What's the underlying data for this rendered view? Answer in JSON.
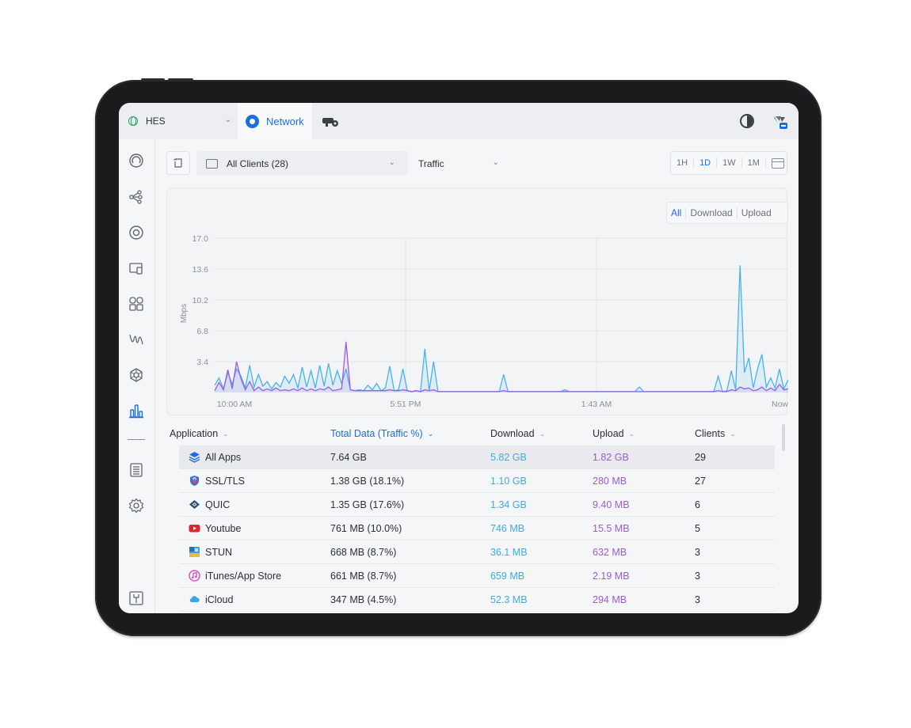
{
  "topbar": {
    "site_name": "HES",
    "network_tab_label": "Network",
    "site_chevron": "⌄"
  },
  "toolbar": {
    "clients_select": "All Clients (28)",
    "metric_select": "Traffic",
    "ranges": [
      "1H",
      "1D",
      "1W",
      "1M"
    ],
    "active_range": "1D",
    "chevron": "⌄"
  },
  "chart": {
    "direction_tabs": [
      "All",
      "Download",
      "Upload"
    ],
    "active_direction": "All",
    "y_ticks": [
      "17.0",
      "13.6",
      "10.2",
      "6.8",
      "3.4"
    ],
    "ylabel": "Mbps",
    "x_ticks": [
      "10:00 AM",
      "5:51 PM",
      "1:43 AM",
      "Now"
    ],
    "download_color": "#4ab3e8",
    "upload_color": "#9b5de5"
  },
  "chart_data": {
    "type": "area",
    "ylabel": "Mbps",
    "ylim": [
      0,
      17.0
    ],
    "x_tick_labels": [
      "10:00 AM",
      "5:51 PM",
      "1:43 AM",
      "Now"
    ],
    "grid": true,
    "series": [
      {
        "name": "Download",
        "color": "#4ab3e8",
        "values": [
          0.8,
          1.6,
          0.4,
          2.2,
          0.9,
          2.6,
          1.8,
          0.5,
          3.0,
          0.6,
          2.0,
          0.7,
          1.2,
          0.4,
          1.1,
          0.6,
          1.8,
          1.0,
          2.0,
          0.5,
          2.8,
          0.6,
          2.4,
          0.5,
          3.0,
          0.7,
          3.2,
          0.8,
          2.4,
          1.0,
          2.6,
          0.3,
          0.2,
          0.3,
          0.2,
          0.8,
          0.3,
          1.0,
          0.2,
          0.5,
          2.9,
          0.2,
          0.3,
          2.6,
          0.2,
          0.1,
          0.2,
          0.1,
          4.8,
          0.2,
          3.4,
          0.1,
          0.1,
          0.1,
          0.1,
          0.1,
          0.1,
          0.1,
          0.1,
          0.1,
          0.1,
          0.1,
          0.1,
          0.1,
          0.1,
          0.1,
          2.0,
          0.1,
          0.1,
          0.1,
          0.1,
          0.1,
          0.1,
          0.1,
          0.1,
          0.1,
          0.1,
          0.1,
          0.1,
          0.1,
          0.3,
          0.1,
          0.1,
          0.1,
          0.1,
          0.1,
          0.1,
          0.1,
          0.1,
          0.1,
          0.1,
          0.1,
          0.1,
          0.1,
          0.1,
          0.1,
          0.1,
          0.6,
          0.1,
          0.1,
          0.1,
          0.1,
          0.1,
          0.1,
          0.1,
          0.1,
          0.1,
          0.1,
          0.1,
          0.1,
          0.1,
          0.1,
          0.1,
          0.1,
          0.1,
          1.8,
          0.1,
          0.2,
          2.4,
          0.3,
          14.0,
          2.2,
          3.8,
          0.5,
          2.6,
          4.2,
          0.6,
          1.6,
          0.5,
          2.6,
          0.4,
          1.4
        ]
      },
      {
        "name": "Upload",
        "color": "#9b5de5",
        "values": [
          0.2,
          1.1,
          0.3,
          2.5,
          0.4,
          3.4,
          1.5,
          0.3,
          1.2,
          0.2,
          0.6,
          0.2,
          0.4,
          0.2,
          0.5,
          0.2,
          0.3,
          0.2,
          0.4,
          0.2,
          0.5,
          0.2,
          0.4,
          0.2,
          0.4,
          0.3,
          0.6,
          0.2,
          0.3,
          0.4,
          5.6,
          0.3,
          0.2,
          0.2,
          0.2,
          0.2,
          0.2,
          0.2,
          0.2,
          0.2,
          0.3,
          0.2,
          0.2,
          0.3,
          0.2,
          0.1,
          0.2,
          0.1,
          0.3,
          0.2,
          0.3,
          0.1,
          0.1,
          0.1,
          0.1,
          0.1,
          0.1,
          0.1,
          0.1,
          0.1,
          0.1,
          0.1,
          0.1,
          0.1,
          0.1,
          0.1,
          0.2,
          0.1,
          0.1,
          0.1,
          0.1,
          0.1,
          0.1,
          0.1,
          0.1,
          0.1,
          0.1,
          0.1,
          0.1,
          0.1,
          0.1,
          0.1,
          0.1,
          0.1,
          0.1,
          0.1,
          0.1,
          0.1,
          0.1,
          0.1,
          0.1,
          0.1,
          0.1,
          0.1,
          0.1,
          0.1,
          0.1,
          0.1,
          0.1,
          0.1,
          0.1,
          0.1,
          0.1,
          0.1,
          0.1,
          0.1,
          0.1,
          0.1,
          0.1,
          0.1,
          0.1,
          0.1,
          0.1,
          0.1,
          0.1,
          0.2,
          0.1,
          0.1,
          0.3,
          0.2,
          0.6,
          0.4,
          0.5,
          0.2,
          0.3,
          0.6,
          0.2,
          0.5,
          0.2,
          0.9,
          0.3,
          0.4
        ]
      }
    ]
  },
  "table": {
    "headers": {
      "application": "Application",
      "total": "Total Data (Traffic %)",
      "download": "Download",
      "upload": "Upload",
      "clients": "Clients"
    },
    "sort_glyph": "⌄",
    "rows": [
      {
        "app": "All Apps",
        "icon": "layers-icon",
        "total": "7.64 GB",
        "download": "5.82 GB",
        "upload": "1.82 GB",
        "clients": "29"
      },
      {
        "app": "SSL/TLS",
        "icon": "shield-lock-icon",
        "total": "1.38 GB (18.1%)",
        "download": "1.10 GB",
        "upload": "280 MB",
        "clients": "27"
      },
      {
        "app": "QUIC",
        "icon": "quic-icon",
        "total": "1.35 GB (17.6%)",
        "download": "1.34 GB",
        "upload": "9.40 MB",
        "clients": "6"
      },
      {
        "app": "Youtube",
        "icon": "youtube-icon",
        "total": "761 MB (10.0%)",
        "download": "746 MB",
        "upload": "15.5 MB",
        "clients": "5"
      },
      {
        "app": "STUN",
        "icon": "stun-icon",
        "total": "668 MB (8.7%)",
        "download": "36.1 MB",
        "upload": "632 MB",
        "clients": "3"
      },
      {
        "app": "iTunes/App Store",
        "icon": "itunes-icon",
        "total": "661 MB (8.7%)",
        "download": "659 MB",
        "upload": "2.19 MB",
        "clients": "3"
      },
      {
        "app": "iCloud",
        "icon": "icloud-icon",
        "total": "347 MB (4.5%)",
        "download": "52.3 MB",
        "upload": "294 MB",
        "clients": "3"
      }
    ]
  }
}
